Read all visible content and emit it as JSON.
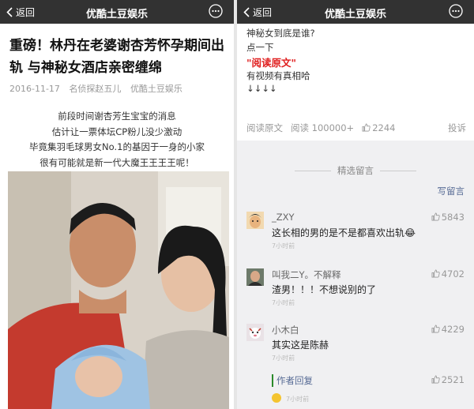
{
  "left": {
    "nav": {
      "back_label": "返回",
      "title": "优酷土豆娱乐"
    },
    "article": {
      "title": "重磅！林丹在老婆谢杏芳怀孕期间出轨 与神秘女酒店亲密缠绵",
      "date": "2016-11-17",
      "author": "名侦探赵五儿",
      "account": "优酷土豆娱乐",
      "lines": [
        "前段时间谢杏芳生宝宝的消息",
        "估计让一票体坛CP粉儿没少激动",
        "毕竟集羽毛球男女No.1的基因于一身的小家",
        "很有可能就是新一代大魔王王王王呢！"
      ]
    }
  },
  "right": {
    "nav": {
      "back_label": "返回",
      "title": "优酷土豆娱乐"
    },
    "article_tail": {
      "line1": "神秘女到底是谁?",
      "line2": "点一下",
      "read_original_highlight": "\"阅读原文\"",
      "line3": "有视频有真相哈",
      "arrows": "↓↓↓↓"
    },
    "stats": {
      "read_original": "阅读原文",
      "reads": "阅读 100000+",
      "likes": "2244",
      "report": "投诉"
    },
    "comments_header": "精选留言",
    "write_comment": "写留言",
    "comments": [
      {
        "name": "_ZXY",
        "text": "这长相的男的是不是都喜欢出轨😂",
        "likes": "5843",
        "time": "7小时前"
      },
      {
        "name": "叫我二Y。不解释",
        "text": "渣男！！！不想说别的了",
        "likes": "4702",
        "time": "7小时前"
      },
      {
        "name": "小木白",
        "text": "其实这是陈赫",
        "likes": "4229",
        "time": "7小时前"
      }
    ],
    "author_reply": {
      "label": "作者回复",
      "likes": "2521",
      "time": "7小时前"
    }
  },
  "colors": {
    "navbar": "#323232",
    "link_blue": "#576b95",
    "highlight_red": "#e02020"
  }
}
